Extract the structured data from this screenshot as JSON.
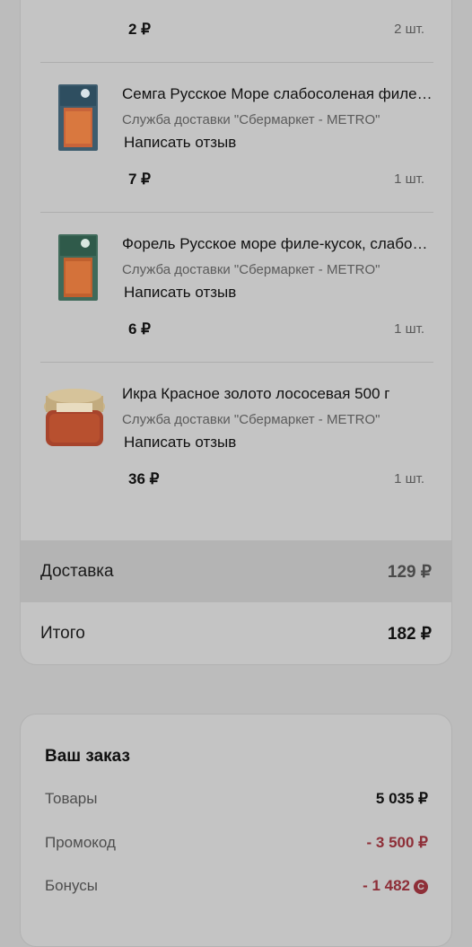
{
  "order": {
    "first_item": {
      "price": "2 ₽",
      "qty": "2 шт."
    },
    "items": [
      {
        "title": "Семга Русское Море слабосоленая филе-кусок",
        "vendor": "Служба доставки \"Сбермаркет - METRO\"",
        "review_label": "Написать отзыв",
        "price": "7 ₽",
        "qty": "1 шт."
      },
      {
        "title": "Форель Русское море филе-кусок, слабосоленая",
        "vendor": "Служба доставки \"Сбермаркет - METRO\"",
        "review_label": "Написать отзыв",
        "price": "6 ₽",
        "qty": "1 шт."
      },
      {
        "title": "Икра Красное золото лососевая 500 г",
        "vendor": "Служба доставки \"Сбермаркет - METRO\"",
        "review_label": "Написать отзыв",
        "price": "36 ₽",
        "qty": "1 шт."
      }
    ],
    "delivery": {
      "label": "Доставка",
      "value": "129 ₽"
    },
    "total": {
      "label": "Итого",
      "value": "182 ₽"
    }
  },
  "summary": {
    "title": "Ваш заказ",
    "goods": {
      "label": "Товары",
      "value": "5 035 ₽"
    },
    "promo": {
      "label": "Промокод",
      "value": "- 3 500 ₽"
    },
    "bonus": {
      "label": "Бонусы",
      "value": "- 1 482"
    }
  },
  "colors": {
    "negative": "#8e2f38",
    "background": "#bcbcbc",
    "card": "#c4c4c4"
  },
  "icons": {
    "bonus": "bonus-coin-icon"
  }
}
